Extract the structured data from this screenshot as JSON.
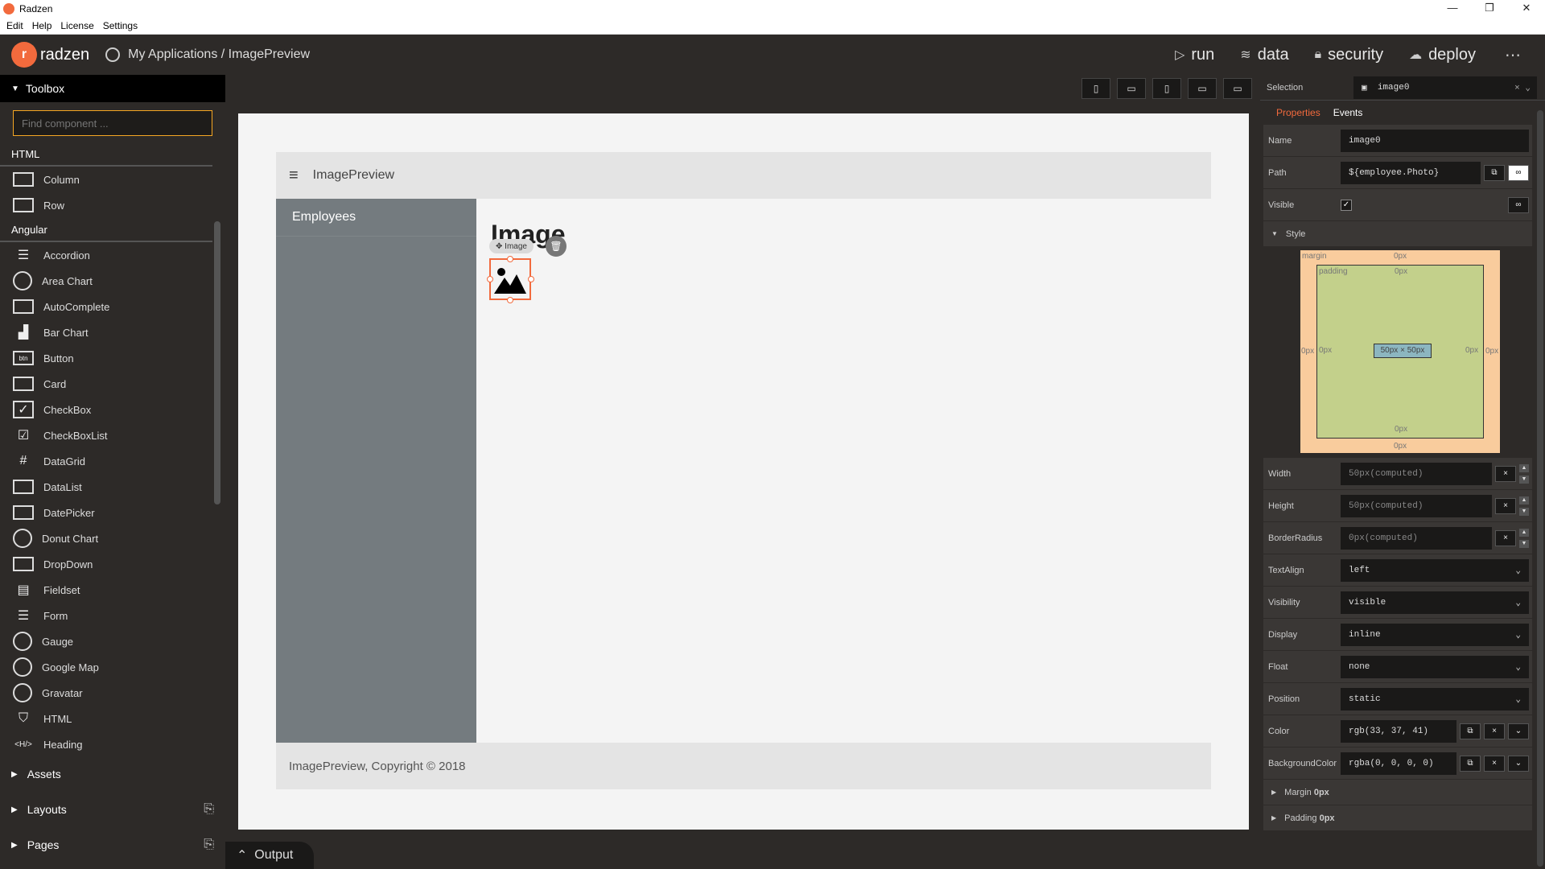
{
  "window": {
    "title": "Radzen"
  },
  "menu": [
    "Edit",
    "Help",
    "License",
    "Settings"
  ],
  "header": {
    "brand": "radzen",
    "breadcrumb": "My Applications / ImagePreview",
    "nav": {
      "run": "run",
      "data": "data",
      "security": "security",
      "deploy": "deploy"
    }
  },
  "toolbox": {
    "title": "Toolbox",
    "search_placeholder": "Find component ...",
    "html_group": "HTML",
    "html_items": [
      "Column",
      "Row"
    ],
    "angular_group": "Angular",
    "angular_items": [
      "Accordion",
      "Area Chart",
      "AutoComplete",
      "Bar Chart",
      "Button",
      "Card",
      "CheckBox",
      "CheckBoxList",
      "DataGrid",
      "DataList",
      "DatePicker",
      "Donut Chart",
      "DropDown",
      "Fieldset",
      "Form",
      "Gauge",
      "Google Map",
      "Gravatar",
      "HTML",
      "Heading"
    ],
    "btn_icon_text": "btn",
    "heading_icon_text": "<H/>"
  },
  "bottom_groups": {
    "assets": "Assets",
    "layouts": "Layouts",
    "pages": "Pages"
  },
  "output": "Output",
  "app": {
    "title": "ImagePreview",
    "sidebar_item": "Employees",
    "heading": "Image",
    "tag": "Image",
    "footer": "ImagePreview, Copyright © 2018"
  },
  "properties": {
    "selection_label": "Selection",
    "selection_value": "image0",
    "tab_properties": "Properties",
    "tab_events": "Events",
    "name_label": "Name",
    "name_value": "image0",
    "path_label": "Path",
    "path_value": "${employee.Photo}",
    "visible_label": "Visible",
    "style_label": "Style",
    "box": {
      "margin": "margin",
      "padding": "padding",
      "zero": "0px",
      "size": "50px × 50px"
    },
    "width_label": "Width",
    "width_value": "50px(computed)",
    "height_label": "Height",
    "height_value": "50px(computed)",
    "radius_label": "BorderRadius",
    "radius_value": "0px(computed)",
    "textalign_label": "TextAlign",
    "textalign_value": "left",
    "visibility_label": "Visibility",
    "visibility_value": "visible",
    "display_label": "Display",
    "display_value": "inline",
    "float_label": "Float",
    "float_value": "none",
    "position_label": "Position",
    "position_value": "static",
    "color_label": "Color",
    "color_value": "rgb(33, 37, 41)",
    "bgcolor_label": "BackgroundColor",
    "bgcolor_value": "rgba(0, 0, 0, 0)",
    "margin_section": "Margin",
    "padding_section": "Padding",
    "section_value": "0px"
  },
  "colors": {
    "accent": "#f26a3d",
    "dark": "#2d2a28",
    "sidebar": "#747b7f"
  }
}
